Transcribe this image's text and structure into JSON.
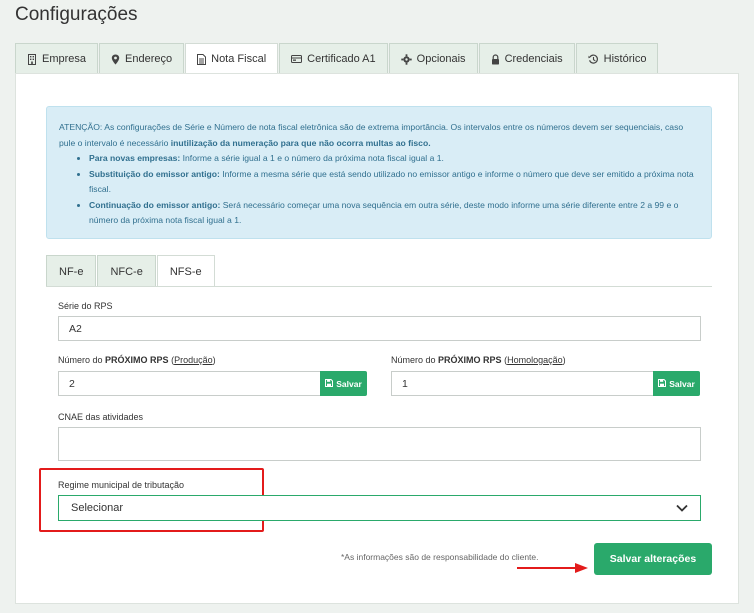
{
  "page": {
    "title": "Configurações"
  },
  "top_tabs": [
    {
      "label": "Empresa",
      "icon": "building-icon"
    },
    {
      "label": "Endereço",
      "icon": "map-pin-icon"
    },
    {
      "label": "Nota Fiscal",
      "icon": "document-icon",
      "active": true
    },
    {
      "label": "Certificado A1",
      "icon": "certificate-icon"
    },
    {
      "label": "Opcionais",
      "icon": "gear-icon"
    },
    {
      "label": "Credenciais",
      "icon": "lock-icon"
    },
    {
      "label": "Histórico",
      "icon": "history-icon"
    }
  ],
  "alert": {
    "title": "ATENÇÃO:",
    "text1": "As configurações de Série e Número de nota fiscal eletrônica são de extrema importância. Os intervalos entre os números devem ser sequenciais, caso pule o intervalo é necessário",
    "text_bold": "inutilização da numeração para que não ocorra multas ao fisco.",
    "items": [
      {
        "title": "Para novas empresas:",
        "text": "Informe a série igual a 1 e o número da próxima nota fiscal igual a 1."
      },
      {
        "title": "Substituição do emissor antigo:",
        "text": "Informe a mesma série que está sendo utilizado no emissor antigo e informe o número que deve ser emitido a próxima nota fiscal."
      },
      {
        "title": "Continuação do emissor antigo:",
        "text": "Será necessário começar uma nova sequência em outra série, deste modo informe uma série diferente entre 2 a 99 e o número da próxima nota fiscal igual a 1."
      }
    ]
  },
  "sub_tabs": [
    {
      "label": "NF-e"
    },
    {
      "label": "NFC-e"
    },
    {
      "label": "NFS-e",
      "active": true
    }
  ],
  "form": {
    "serie_label": "Série do RPS",
    "serie_value": "A2",
    "num_prod_label_pre": "Número do",
    "num_prod_label_bold": "PRÓXIMO RPS",
    "num_prod_label_paren_open": "(",
    "num_prod_label_env": "Produção",
    "num_prod_label_paren_close": ")",
    "num_prod_value": "2",
    "num_homol_label_pre": "Número do",
    "num_homol_label_bold": "PRÓXIMO RPS",
    "num_homol_label_paren_open": "(",
    "num_homol_label_env": "Homologação",
    "num_homol_label_paren_close": ")",
    "num_homol_value": "1",
    "save_label": "Salvar",
    "cnae_label": "CNAE das atividades",
    "cnae_value": "",
    "regime_label": "Regime municipal de tributação",
    "regime_value": "Selecionar"
  },
  "footer": {
    "note": "*As informações são de responsabilidade do cliente.",
    "save_all_label": "Salvar alterações"
  },
  "colors": {
    "accent": "#2aa96b",
    "highlight": "#e31b1b",
    "alert_bg": "#d9edf6",
    "alert_text": "#31708f"
  }
}
